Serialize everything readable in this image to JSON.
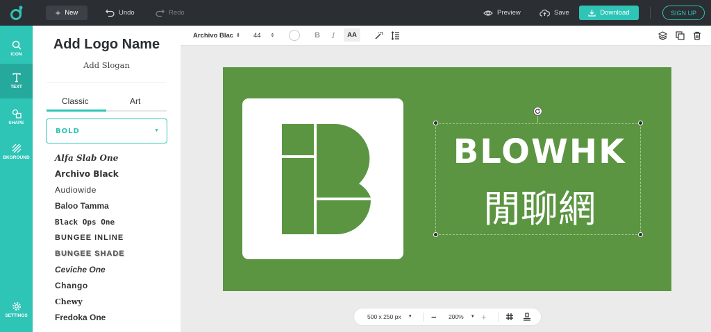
{
  "topbar": {
    "new_label": "New",
    "undo_label": "Undo",
    "redo_label": "Redo",
    "preview_label": "Preview",
    "save_label": "Save",
    "download_label": "Download",
    "signup_label": "SIGN UP"
  },
  "rail": {
    "items": [
      {
        "label": "ICON",
        "icon": "search-icon"
      },
      {
        "label": "TEXT",
        "icon": "text-icon",
        "active": true
      },
      {
        "label": "SHAPE",
        "icon": "shape-icon"
      },
      {
        "label": "BKGROUND",
        "icon": "background-icon"
      }
    ],
    "settings_label": "SETTINGS"
  },
  "panel": {
    "title": "Add Logo Name",
    "slogan": "Add Slogan",
    "tabs": [
      {
        "label": "Classic",
        "active": true
      },
      {
        "label": "Art"
      }
    ],
    "category": "BOLD",
    "fonts": [
      "Alfa Slab One",
      "Archivo Black",
      "Audiowide",
      "Baloo Tamma",
      "Black Ops One",
      "BUNGEE INLINE",
      "BUNGEE SHADE",
      "Ceviche One",
      "Chango",
      "Chewy",
      "Fredoka One"
    ]
  },
  "format": {
    "font_name": "Archivo Blac",
    "font_size": "44",
    "text_color": "#ffffff",
    "bold": "B",
    "italic": "I",
    "caps": "AA"
  },
  "canvas": {
    "background_color": "#5b9541",
    "brand": "BLOWHK",
    "slogan": "閒聊網"
  },
  "zoom": {
    "canvas_size": "500 x 250 px",
    "zoom_level": "200%"
  },
  "colors": {
    "accent": "#2ec4b6",
    "topbar": "#2b2e33"
  }
}
